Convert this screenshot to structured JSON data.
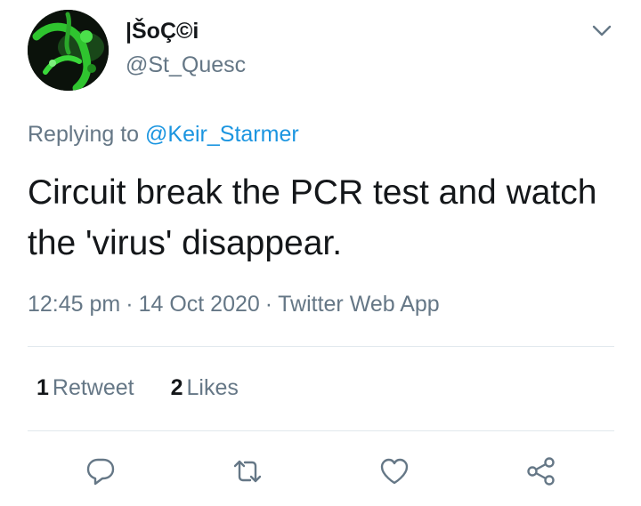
{
  "author": {
    "display_name": "|ŠoÇ©i",
    "handle": "@St_Quesc"
  },
  "reply": {
    "prefix": "Replying to",
    "mention": "@Keir_Starmer"
  },
  "tweet": {
    "text": "Circuit break the PCR test and watch the 'virus' disappear."
  },
  "meta": {
    "time": "12:45 pm",
    "date": "14 Oct 2020",
    "source": "Twitter Web App",
    "separator": "·"
  },
  "stats": {
    "retweets_count": "1",
    "retweets_label": "Retweet",
    "likes_count": "2",
    "likes_label": "Likes"
  },
  "actions": {
    "icons": [
      "reply-icon",
      "retweet-icon",
      "like-icon",
      "share-icon"
    ]
  },
  "colors": {
    "text": "#14171a",
    "secondary": "#657786",
    "link": "#1b95e0",
    "divider": "#e1e8ed",
    "avatar_green": "#2fc42f"
  }
}
